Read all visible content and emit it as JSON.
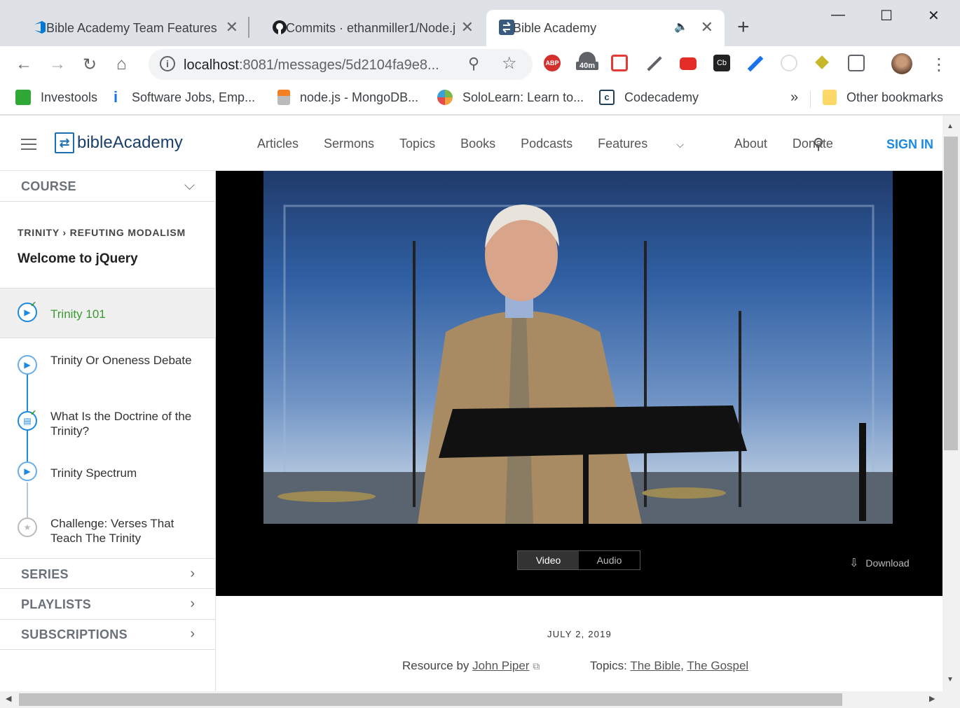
{
  "browser": {
    "tabs": [
      {
        "title": "Bible Academy Team Features |",
        "icon": "azure-devops-icon"
      },
      {
        "title": "Commits · ethanmiller1/Node.j",
        "icon": "github-icon"
      },
      {
        "title": "Bible Academy",
        "icon": "bible-academy-icon",
        "active": true,
        "audio": true
      }
    ],
    "url_host": "localhost",
    "url_rest": ":8081/messages/5d2104fa9e8...",
    "ext_badge": "40m",
    "abp_label": "ABP",
    "cb_label": "Cb",
    "bookmarks": [
      {
        "label": "Investools",
        "icon": "td-icon",
        "color": "#2fa836"
      },
      {
        "label": "Software Jobs, Emp...",
        "icon": "info-icon",
        "color": "#1a73e8"
      },
      {
        "label": "node.js - MongoDB...",
        "icon": "stackoverflow-icon",
        "color": "#f48024"
      },
      {
        "label": "SoloLearn: Learn to...",
        "icon": "sololearn-icon",
        "color": "#7ab648"
      },
      {
        "label": "Codecademy",
        "icon": "codecademy-icon",
        "color": "#1f4056"
      }
    ],
    "overflow": "»",
    "other_bookmarks": "Other bookmarks"
  },
  "site": {
    "logo_text": "bibleAcademy",
    "logo_mark": "⇄",
    "nav": [
      "Articles",
      "Sermons",
      "Topics",
      "Books",
      "Podcasts",
      "Features",
      "About",
      "Donate"
    ],
    "features_chevron": "⌵",
    "signin": "SIGN IN",
    "brand_color": "#1c8ae0"
  },
  "sidebar": {
    "course_label": "COURSE",
    "crumb_parent": "TRINITY",
    "crumb_sep": "›",
    "crumb_child": "REFUTING MODALISM",
    "course_title": "Welcome to jQuery",
    "lessons": [
      {
        "title": "Trinity 101",
        "icon": "play-circle-icon",
        "status": "active",
        "completed": true
      },
      {
        "title": "Trinity Or Oneness Debate",
        "icon": "play-circle-icon",
        "completed": false
      },
      {
        "title": "What Is the Doctrine of the Trinity?",
        "icon": "document-circle-icon",
        "completed": true
      },
      {
        "title": "Trinity Spectrum",
        "icon": "play-circle-icon",
        "completed": false
      },
      {
        "title": "Challenge: Verses That Teach The Trinity",
        "icon": "star-circle-icon",
        "completed": false
      }
    ],
    "sections": [
      "SERIES",
      "PLAYLISTS",
      "SUBSCRIPTIONS"
    ]
  },
  "player": {
    "video_label": "Video",
    "audio_label": "Audio",
    "selected": "Video",
    "download_label": "Download"
  },
  "message": {
    "date": "JULY 2, 2019",
    "resource_prefix": "Resource by",
    "author": "John Piper",
    "topics_prefix": "Topics:",
    "topics": [
      "The Bible",
      "The Gospel"
    ],
    "topic_sep": ","
  }
}
